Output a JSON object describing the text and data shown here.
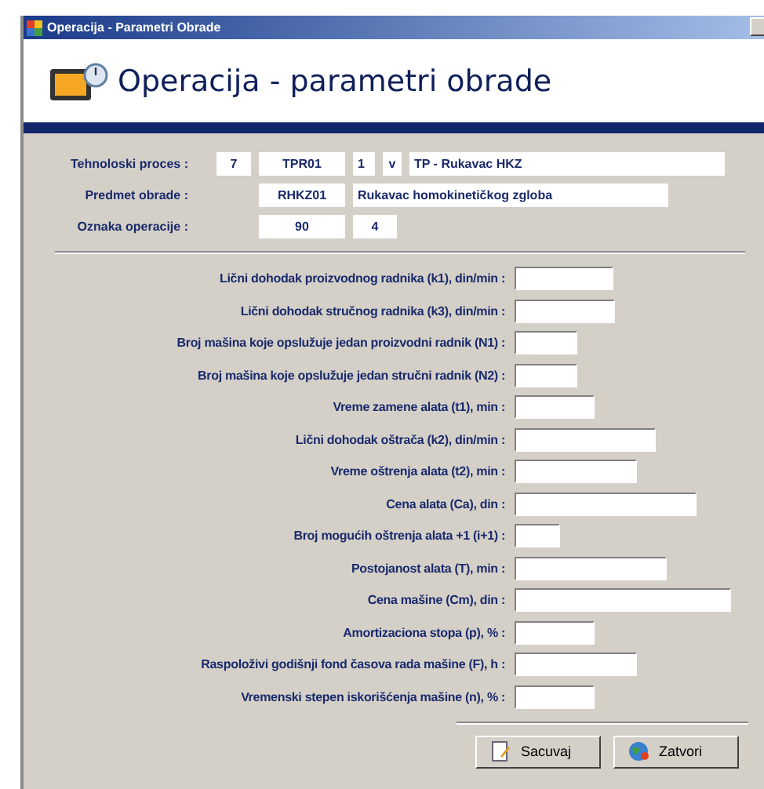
{
  "window": {
    "title": "Operacija - Parametri Obrade"
  },
  "header": {
    "title": "Operacija - parametri obrade"
  },
  "process": {
    "label": "Tehnoloski proces :",
    "number": "7",
    "code": "TPR01",
    "version": "1",
    "variant": "v",
    "name": "TP - Rukavac HKZ"
  },
  "subject": {
    "label": "Predmet obrade :",
    "code": "RHKZ01",
    "name": "Rukavac homokinetičkog zgloba"
  },
  "operation": {
    "label": "Oznaka operacije :",
    "code": "90",
    "number": "4"
  },
  "parameters": [
    {
      "label": "Lični dohodak proizvodnog radnika (k1), din/min :"
    },
    {
      "label": "Lični dohodak stručnog radnika (k3), din/min :"
    },
    {
      "label": "Broj mašina koje opslužuje jedan proizvodni radnik (N1) :"
    },
    {
      "label": "Broj mašina koje opslužuje jedan stručni radnik (N2) :"
    },
    {
      "label": "Vreme zamene alata (t1), min :"
    },
    {
      "label": "Lični dohodak oštrača (k2), din/min :"
    },
    {
      "label": "Vreme oštrenja alata (t2), min :"
    },
    {
      "label": "Cena alata (Ca), din :"
    },
    {
      "label": "Broj mogućih oštrenja alata +1 (i+1) :"
    },
    {
      "label": "Postojanost alata (T), min :"
    },
    {
      "label": "Cena mašine (Cm), din :"
    },
    {
      "label": "Amortizaciona stopa (p), % :"
    },
    {
      "label": "Raspoloživi godišnji fond časova rada mašine (F), h :"
    },
    {
      "label": "Vremenski stepen iskorišćenja mašine (n), % :"
    }
  ],
  "buttons": [
    {
      "kind": "save",
      "label": "Sacuvaj"
    },
    {
      "kind": "close",
      "label": "Zatvori"
    }
  ]
}
